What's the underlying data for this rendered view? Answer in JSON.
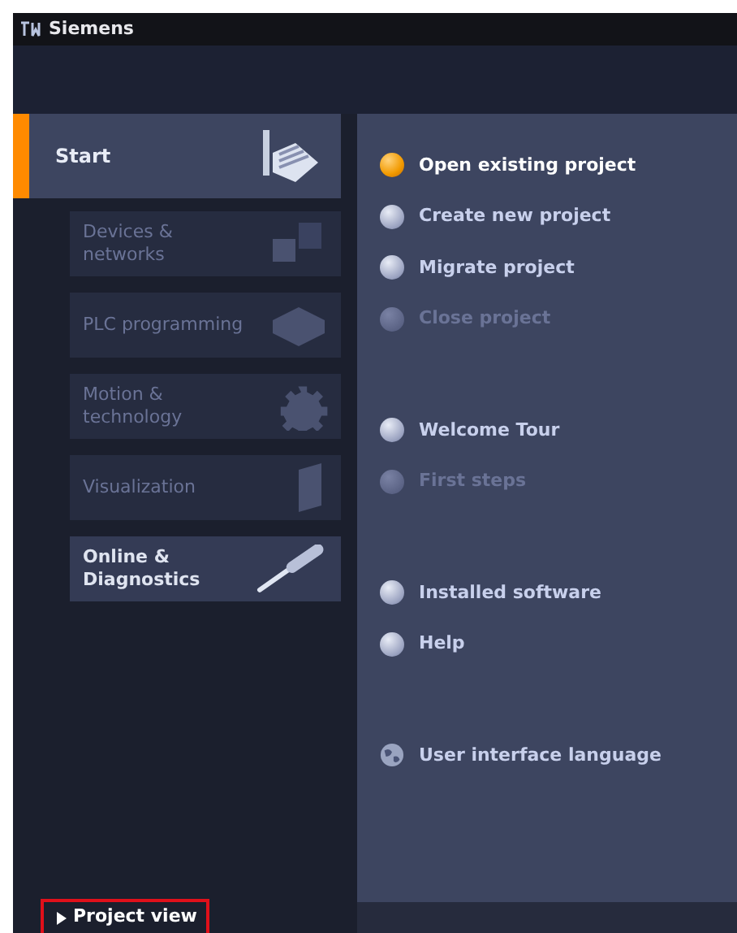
{
  "window": {
    "title": "Siemens"
  },
  "sidebar": {
    "items": [
      {
        "label": "Start",
        "selected": true,
        "kind": "start",
        "children": [
          {
            "label": "Devices & networks",
            "disabled": true,
            "kind": "devices"
          },
          {
            "label": "PLC programming",
            "disabled": true,
            "kind": "plc"
          },
          {
            "label": "Motion & technology",
            "disabled": true,
            "kind": "motion"
          },
          {
            "label": "Visualization",
            "disabled": true,
            "kind": "visualization"
          },
          {
            "label": "Online & Diagnostics",
            "disabled": false,
            "kind": "online"
          }
        ]
      }
    ]
  },
  "action_groups": [
    {
      "items": [
        {
          "label": "Open existing project",
          "selected": true,
          "disabled": false,
          "kind": "bullet"
        },
        {
          "label": "Create new project",
          "selected": false,
          "disabled": false,
          "kind": "bullet"
        },
        {
          "label": "Migrate project",
          "selected": false,
          "disabled": false,
          "kind": "bullet"
        },
        {
          "label": "Close project",
          "selected": false,
          "disabled": true,
          "kind": "bullet"
        }
      ]
    },
    {
      "items": [
        {
          "label": "Welcome Tour",
          "selected": false,
          "disabled": false,
          "kind": "bullet"
        },
        {
          "label": "First steps",
          "selected": false,
          "disabled": true,
          "kind": "bullet"
        }
      ]
    },
    {
      "items": [
        {
          "label": "Installed software",
          "selected": false,
          "disabled": false,
          "kind": "bullet"
        },
        {
          "label": "Help",
          "selected": false,
          "disabled": false,
          "kind": "bullet"
        }
      ]
    },
    {
      "items": [
        {
          "label": "User interface language",
          "selected": false,
          "disabled": false,
          "kind": "globe"
        }
      ]
    }
  ],
  "project_view": {
    "label": "Project view",
    "highlighted": true
  }
}
